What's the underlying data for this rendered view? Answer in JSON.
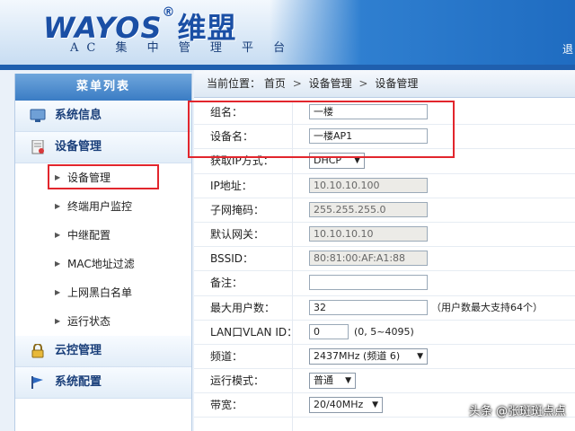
{
  "header": {
    "brand": "WAYOS",
    "brand_reg": "®",
    "brand_cn": "维盟",
    "subtitle": "AC 集 中 管 理 平 台",
    "right_link": "退"
  },
  "sidebar": {
    "title": "菜单列表",
    "sections": [
      {
        "label": "系统信息",
        "icon": "monitor-icon"
      },
      {
        "label": "设备管理",
        "icon": "document-icon"
      },
      {
        "label": "云控管理",
        "icon": "lock-icon"
      },
      {
        "label": "系统配置",
        "icon": "flag-icon"
      }
    ],
    "sub_items": [
      {
        "label": "设备管理"
      },
      {
        "label": "终端用户监控"
      },
      {
        "label": "中继配置"
      },
      {
        "label": "MAC地址过滤"
      },
      {
        "label": "上网黑白名单"
      },
      {
        "label": "运行状态"
      }
    ]
  },
  "breadcrumb": {
    "prefix": "当前位置：",
    "items": [
      "首页",
      "设备管理",
      "设备管理"
    ],
    "sep": ">"
  },
  "form": {
    "group_name": {
      "label": "组名：",
      "value": "一楼"
    },
    "device_name": {
      "label": "设备名：",
      "value": "一楼AP1"
    },
    "ip_method": {
      "label": "获取IP方式：",
      "value": "DHCP"
    },
    "ip_address": {
      "label": "IP地址：",
      "value": "10.10.10.100"
    },
    "subnet_mask": {
      "label": "子网掩码：",
      "value": "255.255.255.0"
    },
    "gateway": {
      "label": "默认网关：",
      "value": "10.10.10.10"
    },
    "bssid": {
      "label": "BSSID：",
      "value": "80:81:00:AF:A1:88"
    },
    "note": {
      "label": "备注：",
      "value": ""
    },
    "max_users": {
      "label": "最大用户数：",
      "value": "32",
      "hint": "（用户数最大支持64个）"
    },
    "lan_vlan": {
      "label": "LAN口VLAN ID：",
      "value": "0",
      "hint": "(0, 5~4095)"
    },
    "channel": {
      "label": "频道：",
      "value": "2437MHz (频道 6)"
    },
    "run_mode": {
      "label": "运行模式：",
      "value": "普通"
    },
    "bandwidth": {
      "label": "带宽：",
      "value": "20/40MHz"
    }
  },
  "watermark": "头条 @张斑斑点点",
  "colors": {
    "accent": "#1f5fae",
    "highlight": "#e2262d"
  }
}
